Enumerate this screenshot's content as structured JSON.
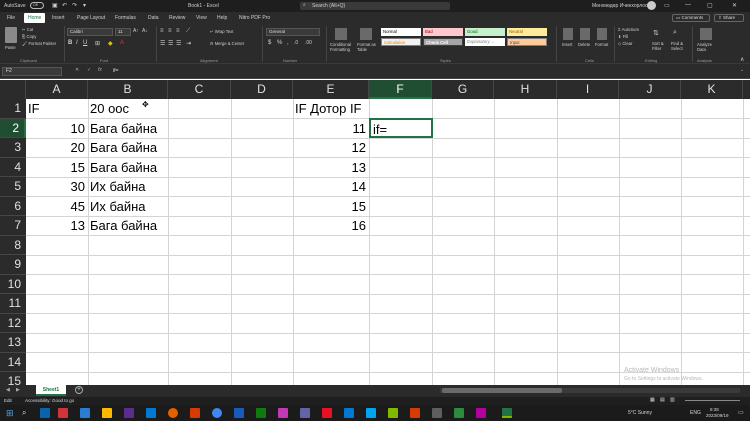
{
  "titlebar": {
    "autosave": "AutoSave",
    "autosave_state": "Off",
    "title": "Book1 - Excel",
    "search": "Search (Alt+Q)",
    "user": "Мөнхөөдөр Ичинхорлоо"
  },
  "menu": {
    "tabs": [
      "File",
      "Home",
      "Insert",
      "Page Layout",
      "Formulas",
      "Data",
      "Review",
      "View",
      "Help",
      "Nitro PDF Pro"
    ],
    "comments": "Comments",
    "share": "Share"
  },
  "ribbon": {
    "paste": "Paste",
    "cut": "Cut",
    "copy": "Copy",
    "format_painter": "Format Painter",
    "font_name": "Calibri",
    "font_size": "11",
    "wrap_text": "Wrap Text",
    "merge_center": "Merge & Center",
    "number_format": "General",
    "conditional_formatting": "Conditional Formatting",
    "format_as_table": "Format as Table",
    "styles": [
      "Normal",
      "Bad",
      "Good",
      "Neutral",
      "Calculation",
      "Check Cell",
      "Explanatory ...",
      "Input"
    ],
    "insert": "Insert",
    "delete": "Delete",
    "format": "Format",
    "autosum": "AutoSum",
    "fill": "Fill",
    "clear": "Clear",
    "sort_filter": "Sort & Filter",
    "find_select": "Find & Select",
    "analyze": "Analyze Data",
    "groups": [
      "Clipboard",
      "Font",
      "Alignment",
      "Number",
      "Styles",
      "Cells",
      "Editing",
      "Analysis"
    ]
  },
  "formula_bar": {
    "name_box": "F2",
    "fx": "fx",
    "content": "if="
  },
  "columns": [
    "A",
    "B",
    "C",
    "D",
    "E",
    "F",
    "G",
    "H",
    "I",
    "J",
    "K"
  ],
  "rows": [
    "1",
    "2",
    "3",
    "4",
    "5",
    "6",
    "7",
    "8",
    "9",
    "10",
    "11",
    "12",
    "13",
    "14",
    "15"
  ],
  "cells": {
    "a1": "IF",
    "b1": "20 оос",
    "e1": "IF Дотор IF",
    "a2": "10",
    "b2": "Бага байна",
    "e2": "11",
    "f2": "if=",
    "a3": "20",
    "b3": "Бага байна",
    "e3": "12",
    "a4": "15",
    "b4": "Бага байна",
    "e4": "13",
    "a5": "30",
    "b5": "Их байна",
    "e5": "14",
    "a6": "45",
    "b6": "Их байна",
    "e6": "15",
    "a7": "13",
    "b7": "Бага байна",
    "e7": "16"
  },
  "sheet_tabs": [
    "Sheet1"
  ],
  "status": {
    "mode": "Edit",
    "accessibility": "Accessibility: Good to go"
  },
  "watermark": {
    "line1": "Activate Windows",
    "line2": "Go to Settings to activate Windows."
  },
  "taskbar": {
    "weather": "5°C  Sunny",
    "lang": "ENG",
    "time": "8:38",
    "date": "2023/09/19"
  },
  "colors": {
    "selection": "#217346",
    "dark_bg": "#2b2b2b",
    "grid": "#d4d4d4"
  }
}
